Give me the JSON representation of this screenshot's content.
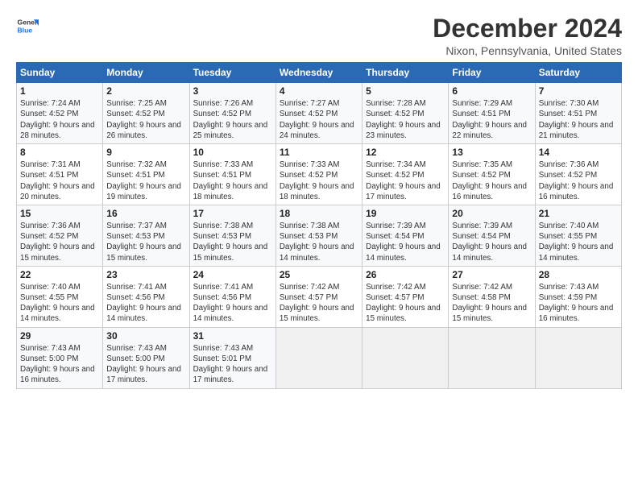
{
  "logo": {
    "line1": "General",
    "line2": "Blue"
  },
  "title": "December 2024",
  "subtitle": "Nixon, Pennsylvania, United States",
  "weekdays": [
    "Sunday",
    "Monday",
    "Tuesday",
    "Wednesday",
    "Thursday",
    "Friday",
    "Saturday"
  ],
  "weeks": [
    [
      {
        "day": "1",
        "sunrise": "7:24 AM",
        "sunset": "4:52 PM",
        "daylight": "9 hours and 28 minutes."
      },
      {
        "day": "2",
        "sunrise": "7:25 AM",
        "sunset": "4:52 PM",
        "daylight": "9 hours and 26 minutes."
      },
      {
        "day": "3",
        "sunrise": "7:26 AM",
        "sunset": "4:52 PM",
        "daylight": "9 hours and 25 minutes."
      },
      {
        "day": "4",
        "sunrise": "7:27 AM",
        "sunset": "4:52 PM",
        "daylight": "9 hours and 24 minutes."
      },
      {
        "day": "5",
        "sunrise": "7:28 AM",
        "sunset": "4:52 PM",
        "daylight": "9 hours and 23 minutes."
      },
      {
        "day": "6",
        "sunrise": "7:29 AM",
        "sunset": "4:51 PM",
        "daylight": "9 hours and 22 minutes."
      },
      {
        "day": "7",
        "sunrise": "7:30 AM",
        "sunset": "4:51 PM",
        "daylight": "9 hours and 21 minutes."
      }
    ],
    [
      {
        "day": "8",
        "sunrise": "7:31 AM",
        "sunset": "4:51 PM",
        "daylight": "9 hours and 20 minutes."
      },
      {
        "day": "9",
        "sunrise": "7:32 AM",
        "sunset": "4:51 PM",
        "daylight": "9 hours and 19 minutes."
      },
      {
        "day": "10",
        "sunrise": "7:33 AM",
        "sunset": "4:51 PM",
        "daylight": "9 hours and 18 minutes."
      },
      {
        "day": "11",
        "sunrise": "7:33 AM",
        "sunset": "4:52 PM",
        "daylight": "9 hours and 18 minutes."
      },
      {
        "day": "12",
        "sunrise": "7:34 AM",
        "sunset": "4:52 PM",
        "daylight": "9 hours and 17 minutes."
      },
      {
        "day": "13",
        "sunrise": "7:35 AM",
        "sunset": "4:52 PM",
        "daylight": "9 hours and 16 minutes."
      },
      {
        "day": "14",
        "sunrise": "7:36 AM",
        "sunset": "4:52 PM",
        "daylight": "9 hours and 16 minutes."
      }
    ],
    [
      {
        "day": "15",
        "sunrise": "7:36 AM",
        "sunset": "4:52 PM",
        "daylight": "9 hours and 15 minutes."
      },
      {
        "day": "16",
        "sunrise": "7:37 AM",
        "sunset": "4:53 PM",
        "daylight": "9 hours and 15 minutes."
      },
      {
        "day": "17",
        "sunrise": "7:38 AM",
        "sunset": "4:53 PM",
        "daylight": "9 hours and 15 minutes."
      },
      {
        "day": "18",
        "sunrise": "7:38 AM",
        "sunset": "4:53 PM",
        "daylight": "9 hours and 14 minutes."
      },
      {
        "day": "19",
        "sunrise": "7:39 AM",
        "sunset": "4:54 PM",
        "daylight": "9 hours and 14 minutes."
      },
      {
        "day": "20",
        "sunrise": "7:39 AM",
        "sunset": "4:54 PM",
        "daylight": "9 hours and 14 minutes."
      },
      {
        "day": "21",
        "sunrise": "7:40 AM",
        "sunset": "4:55 PM",
        "daylight": "9 hours and 14 minutes."
      }
    ],
    [
      {
        "day": "22",
        "sunrise": "7:40 AM",
        "sunset": "4:55 PM",
        "daylight": "9 hours and 14 minutes."
      },
      {
        "day": "23",
        "sunrise": "7:41 AM",
        "sunset": "4:56 PM",
        "daylight": "9 hours and 14 minutes."
      },
      {
        "day": "24",
        "sunrise": "7:41 AM",
        "sunset": "4:56 PM",
        "daylight": "9 hours and 14 minutes."
      },
      {
        "day": "25",
        "sunrise": "7:42 AM",
        "sunset": "4:57 PM",
        "daylight": "9 hours and 15 minutes."
      },
      {
        "day": "26",
        "sunrise": "7:42 AM",
        "sunset": "4:57 PM",
        "daylight": "9 hours and 15 minutes."
      },
      {
        "day": "27",
        "sunrise": "7:42 AM",
        "sunset": "4:58 PM",
        "daylight": "9 hours and 15 minutes."
      },
      {
        "day": "28",
        "sunrise": "7:43 AM",
        "sunset": "4:59 PM",
        "daylight": "9 hours and 16 minutes."
      }
    ],
    [
      {
        "day": "29",
        "sunrise": "7:43 AM",
        "sunset": "5:00 PM",
        "daylight": "9 hours and 16 minutes."
      },
      {
        "day": "30",
        "sunrise": "7:43 AM",
        "sunset": "5:00 PM",
        "daylight": "9 hours and 17 minutes."
      },
      {
        "day": "31",
        "sunrise": "7:43 AM",
        "sunset": "5:01 PM",
        "daylight": "9 hours and 17 minutes."
      },
      null,
      null,
      null,
      null
    ]
  ]
}
